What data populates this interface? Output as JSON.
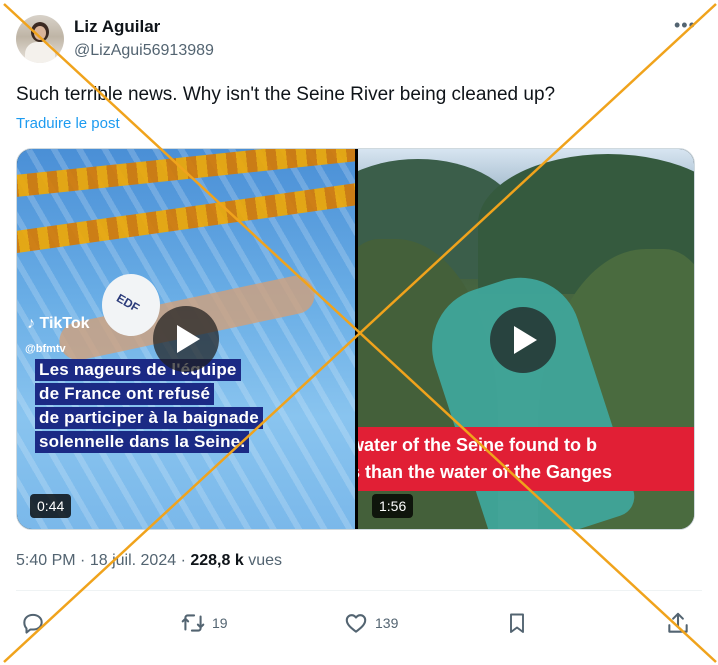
{
  "author": {
    "name": "Liz Aguilar",
    "handle": "@LizAgui56913989"
  },
  "more_icon": "more-dots-icon",
  "tweet": {
    "text": "Such terrible news. Why isn't the Seine River being cleaned up?",
    "translate_label": "Traduire le post"
  },
  "media": {
    "video1": {
      "tiktok_label": "TikTok",
      "tiktok_handle": "@bfmtv",
      "caption_lines": [
        "Les nageurs de l'équipe",
        "de France ont refusé",
        "de participer à la baignade",
        "solennelle dans la Seine."
      ],
      "cap_text": "EDF",
      "duration": "0:44"
    },
    "video2": {
      "banner_lines": [
        "water of the Seine found to b",
        "s than the water of the Ganges"
      ],
      "duration": "1:56"
    }
  },
  "meta": {
    "time": "5:40 PM",
    "sep1": "·",
    "date": "18 juil. 2024",
    "sep2": "·",
    "views_count": "228,8 k",
    "views_label": "vues"
  },
  "actions": {
    "reply_icon": "reply-icon",
    "retweet_icon": "retweet-icon",
    "retweet_count": "19",
    "like_icon": "heart-icon",
    "like_count": "139",
    "bookmark_icon": "bookmark-icon",
    "share_icon": "share-icon"
  },
  "colors": {
    "link": "#1d9bf0",
    "muted": "#536471",
    "cross_overlay": "#f0a31c",
    "caption_bg": "#1b2a85",
    "banner_bg": "#e11f35"
  }
}
